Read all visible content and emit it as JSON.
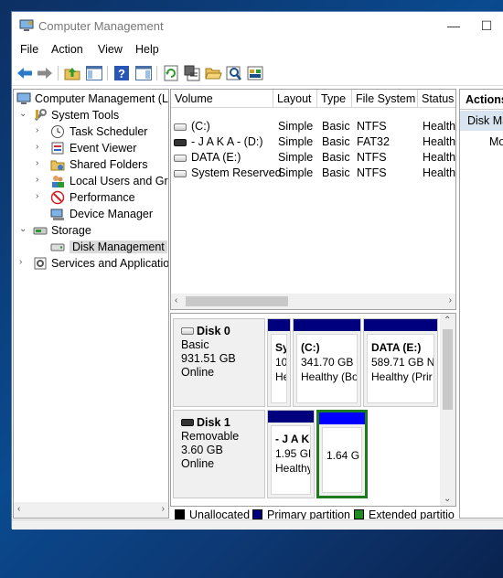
{
  "window": {
    "title": "Computer Management",
    "minimize": "—",
    "maximize": "☐"
  },
  "menu": [
    "File",
    "Action",
    "View",
    "Help"
  ],
  "toolbar": {
    "icons": [
      "back-icon",
      "forward-icon",
      "up-folder-icon",
      "show-hide-tree-icon",
      "help-icon",
      "show-hide-action-pane-icon",
      "refresh-icon",
      "properties-icon",
      "open-folder-icon",
      "search-icon",
      "settings-icon"
    ]
  },
  "tree": {
    "root": "Computer Management (L",
    "system_tools": "System Tools",
    "task_scheduler": "Task Scheduler",
    "event_viewer": "Event Viewer",
    "shared_folders": "Shared Folders",
    "local_users": "Local Users and Gro",
    "performance": "Performance",
    "device_manager": "Device Manager",
    "storage": "Storage",
    "disk_management": "Disk Management",
    "services": "Services and Applicatio"
  },
  "volumes": {
    "columns": [
      "Volume",
      "Layout",
      "Type",
      "File System",
      "Status"
    ],
    "rows": [
      {
        "volume": "(C:)",
        "layout": "Simple",
        "type": "Basic",
        "fs": "NTFS",
        "status": "Health"
      },
      {
        "volume": "- J A K A - (D:)",
        "layout": "Simple",
        "type": "Basic",
        "fs": "FAT32",
        "status": "Health"
      },
      {
        "volume": "DATA (E:)",
        "layout": "Simple",
        "type": "Basic",
        "fs": "NTFS",
        "status": "Health"
      },
      {
        "volume": "System Reserved",
        "layout": "Simple",
        "type": "Basic",
        "fs": "NTFS",
        "status": "Health"
      }
    ]
  },
  "disks": [
    {
      "name": "Disk 0",
      "type": "Basic",
      "size": "931.51 GB",
      "state": "Online",
      "partitions": [
        {
          "name": "Sy",
          "size": "10",
          "status": "He"
        },
        {
          "name": "(C:)",
          "size": "341.70 GB N",
          "status": "Healthy (Bo"
        },
        {
          "name": "DATA  (E:)",
          "size": "589.71 GB N",
          "status": "Healthy (Prir"
        }
      ]
    },
    {
      "name": "Disk 1",
      "type": "Removable",
      "size": "3.60 GB",
      "state": "Online",
      "partitions": [
        {
          "name": "- J A K",
          "size": "1.95 GB",
          "status": "Healthy"
        },
        {
          "name": "",
          "size": "1.64 G",
          "status": ""
        }
      ]
    }
  ],
  "legend": [
    "Unallocated",
    "Primary partition",
    "Extended partitio"
  ],
  "colors": {
    "primary": "#00007f",
    "extended": "#1e8c1e",
    "unallocated": "#000000",
    "free_space": "#0000ff"
  },
  "actions": {
    "header": "Actions",
    "sub": "Disk Ma",
    "item": "Mo"
  }
}
